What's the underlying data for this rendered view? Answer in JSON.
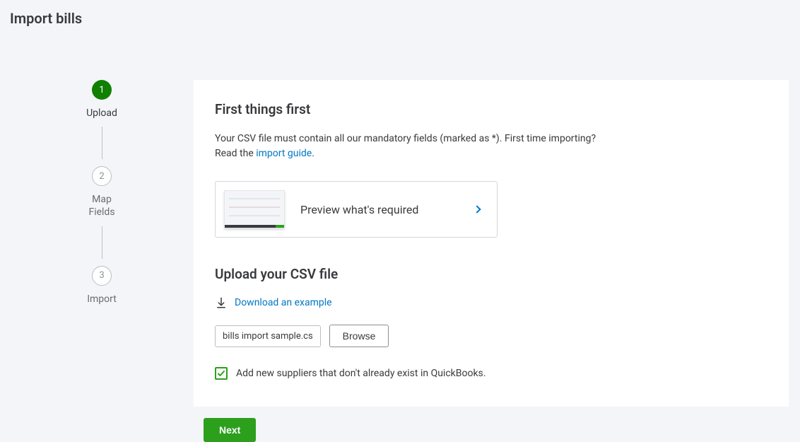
{
  "page_title": "Import bills",
  "stepper": {
    "steps": [
      {
        "num": "1",
        "label": "Upload",
        "active": true
      },
      {
        "num": "2",
        "label": "Map\nFields",
        "active": false
      },
      {
        "num": "3",
        "label": "Import",
        "active": false
      }
    ]
  },
  "first": {
    "heading": "First things first",
    "body_1": "Your CSV file must contain all our mandatory fields (marked as *). First time importing?",
    "body_2": "Read the ",
    "guide_link": "import guide",
    "period": "."
  },
  "preview": {
    "label": "Preview what's required"
  },
  "upload": {
    "heading": "Upload your CSV file",
    "download_link": "Download an example",
    "filename": "bills import sample.cs",
    "browse": "Browse"
  },
  "checkbox": {
    "checked": true,
    "label": "Add new suppliers that don't already exist in QuickBooks."
  },
  "footer": {
    "next": "Next"
  }
}
